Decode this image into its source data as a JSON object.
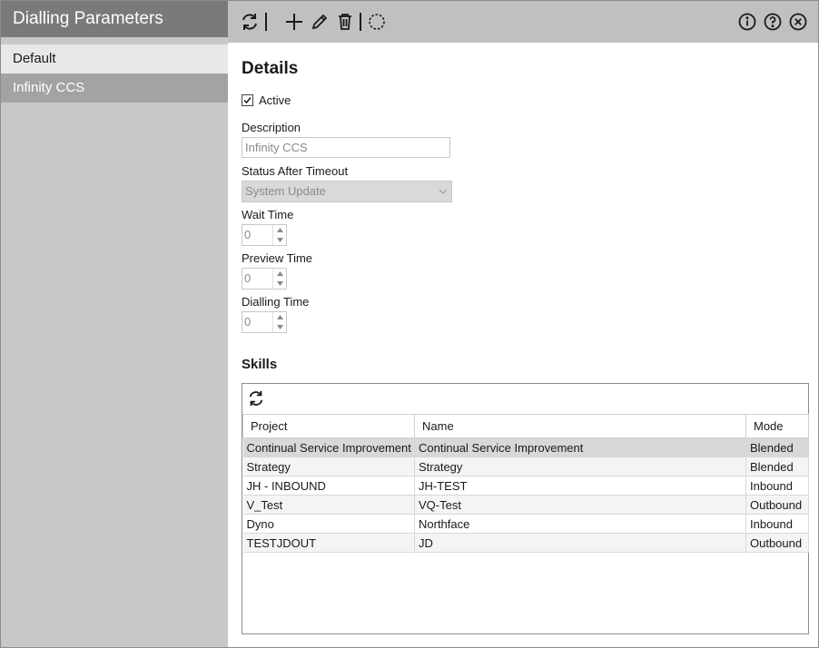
{
  "sidebar": {
    "title": "Dialling Parameters",
    "items": [
      {
        "label": "Default"
      },
      {
        "label": "Infinity CCS"
      }
    ]
  },
  "toolbar": {
    "icons": [
      "refresh-icon",
      "add-icon",
      "edit-icon",
      "delete-icon",
      "loading-icon",
      "info-icon",
      "help-icon",
      "close-icon"
    ]
  },
  "details": {
    "title": "Details",
    "active_label": "Active",
    "active_checked": true,
    "description_label": "Description",
    "description_value": "Infinity CCS",
    "status_label": "Status After Timeout",
    "status_value": "System Update",
    "wait_label": "Wait Time",
    "wait_value": "0",
    "preview_label": "Preview Time",
    "preview_value": "0",
    "dialling_label": "Dialling Time",
    "dialling_value": "0"
  },
  "skills": {
    "title": "Skills",
    "columns": {
      "project": "Project",
      "name": "Name",
      "mode": "Mode"
    },
    "rows": [
      {
        "project": "Continual Service Improvement",
        "name": "Continual Service Improvement",
        "mode": "Blended"
      },
      {
        "project": "Strategy",
        "name": "Strategy",
        "mode": "Blended"
      },
      {
        "project": "JH - INBOUND",
        "name": "JH-TEST",
        "mode": "Inbound"
      },
      {
        "project": "V_Test",
        "name": "VQ-Test",
        "mode": "Outbound"
      },
      {
        "project": "Dyno",
        "name": "Northface",
        "mode": "Inbound"
      },
      {
        "project": "TESTJDOUT",
        "name": "JD",
        "mode": "Outbound"
      }
    ]
  },
  "colors": {
    "sidebar_header": "#7a7a7a",
    "sidebar_bg": "#c8c8c8",
    "sidebar_selected": "#a3a3a3",
    "toolbar_bg": "#c0c0c0",
    "row_selected": "#d8d8d8"
  }
}
